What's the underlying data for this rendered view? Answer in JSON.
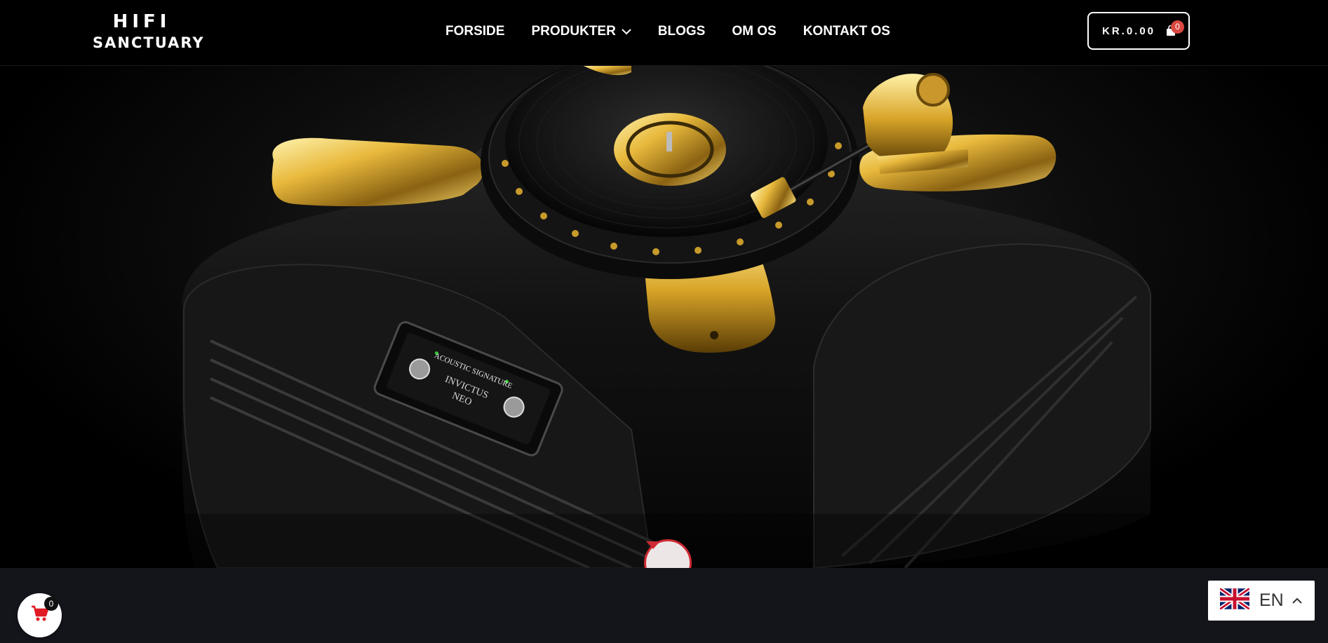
{
  "header": {
    "logo": {
      "line1": "HIFI",
      "line2": "SANCTUARY"
    },
    "nav": [
      {
        "label": "FORSIDE"
      },
      {
        "label": "PRODUKTER",
        "has_dropdown": true
      },
      {
        "label": "BLOGS"
      },
      {
        "label": "OM OS"
      },
      {
        "label": "KONTAKT OS"
      }
    ],
    "cart": {
      "total": "KR.0.00",
      "count": "0",
      "icon": "shopping-bag-icon"
    }
  },
  "hero": {
    "image": "turntable-hero",
    "panel_brand": "ACOUSTIC SIGNATURE",
    "panel_model_line1": "INVICTUS",
    "panel_model_line2": "NEO",
    "scroll_icon": "caret-down-icon",
    "accent_color": "#d02a34"
  },
  "floating_cart": {
    "count": "0",
    "icon": "shopping-cart-icon",
    "color": "#e01b24"
  },
  "language": {
    "label": "EN",
    "flag": "uk-flag-icon",
    "icon": "chevron-up-icon"
  }
}
